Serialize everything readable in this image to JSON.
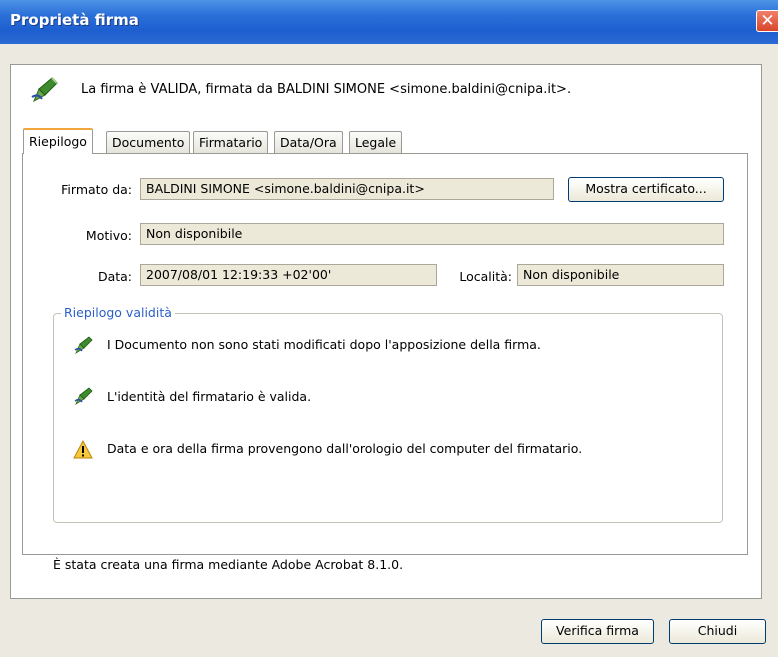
{
  "window": {
    "title": "Proprietà firma",
    "close_glyph": "✕"
  },
  "header": {
    "status_icon": "pen-check-icon",
    "message": "La firma è VALIDA, firmata da BALDINI SIMONE <simone.baldini@cnipa.it>."
  },
  "tabs": [
    {
      "label": "Riepilogo",
      "active": true
    },
    {
      "label": "Documento",
      "active": false
    },
    {
      "label": "Firmatario",
      "active": false
    },
    {
      "label": "Data/Ora",
      "active": false
    },
    {
      "label": "Legale",
      "active": false
    }
  ],
  "summary": {
    "signed_by_label": "Firmato da:",
    "signed_by_value": "BALDINI SIMONE <simone.baldini@cnipa.it>",
    "show_certificate_button": "Mostra certificato...",
    "reason_label": "Motivo:",
    "reason_value": "Non disponibile",
    "date_label": "Data:",
    "date_value": "2007/08/01 12:19:33 +02'00'",
    "location_label": "Località:",
    "location_value": "Non disponibile"
  },
  "validity": {
    "title": "Riepilogo validità",
    "items": [
      {
        "icon": "pen-check-icon",
        "text": "I Documento non sono stati modificati dopo l'apposizione della firma."
      },
      {
        "icon": "pen-check-icon",
        "text": "L'identità del firmatario è valida."
      },
      {
        "icon": "warning-icon",
        "text": "Data e ora della firma provengono dall'orologio del computer del firmatario."
      }
    ]
  },
  "footer": {
    "note": "È stata creata una firma mediante Adobe Acrobat 8.1.0."
  },
  "buttons": {
    "verify": "Verifica firma",
    "close": "Chiudi"
  },
  "colors": {
    "titlebar": "#2a6fd8",
    "group_title": "#2b60c8",
    "active_tab_accent": "#f0a63c",
    "field_bg": "#ece9d8"
  }
}
